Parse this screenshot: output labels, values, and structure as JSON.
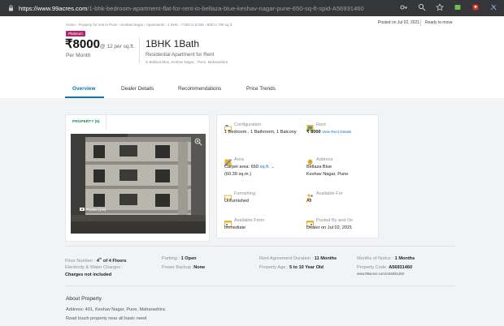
{
  "browser": {
    "url_host": "https://www.99acres.com",
    "url_path": "/1-bhk-bedroom-apartment-flat-for-rent-in-bellaza-blue-keshav-nagar-pune-650-sq-ft-spid-A56931460",
    "icons": [
      "key-icon",
      "search-icon",
      "star-icon",
      "extension-icon",
      "profile-icon",
      "menu-icon"
    ]
  },
  "header": {
    "breadcrumb": "Home › Property for rent in Pune › Keshav Nagar › Apartments › 1 BHK › 7,000 to 8,000 › 600 to 700 sq.ft.",
    "posted_on": "Posted on Jul 02, 2021",
    "status": "Ready to move",
    "badge": "Platinum",
    "price": "₹8000",
    "price_sqft": "@ 12 per sq.ft.",
    "per_month": "Per Month",
    "title": "1BHK 1Bath",
    "subtitle": "Residential Apartment for Rent",
    "address_small": "in Bellaza Blue, Keshav Nagar, , Pune, Maharashtra"
  },
  "tabs": [
    {
      "label": "Overview",
      "active": true
    },
    {
      "label": "Dealer Details",
      "active": false
    },
    {
      "label": "Recommendations",
      "active": false
    },
    {
      "label": "Price Trends",
      "active": false
    }
  ],
  "property_card": {
    "tab_label": "PROPERTY (6)",
    "photos_label": "Photos (1/6)"
  },
  "details": {
    "configuration": {
      "label": "Configuration",
      "value": "1 Bedroom , 1 Bathroom, 1 Balcony"
    },
    "rent": {
      "label": "Rent",
      "value": "₹ 8000",
      "link": "View Rent Details"
    },
    "area": {
      "label": "Area",
      "value_prefix": "Carpet area: 650",
      "unit": "sq.ft.",
      "value_sub": "(60.39 sq.m.)"
    },
    "address": {
      "label": "Address",
      "line1": "Bellaza Blue",
      "line2": "Keshav Nagar, Pune"
    },
    "furnishing": {
      "label": "Furnishing",
      "value": "Unfurnished"
    },
    "available_for": {
      "label": "Available For",
      "value": "All"
    },
    "available_from": {
      "label": "Available From",
      "value": "Immediate"
    },
    "posted_by": {
      "label": "Posted By and On",
      "value": "Dealer on Jul 02, 2021"
    }
  },
  "facts": {
    "floor_label": "Floor Number :",
    "floor_value": "4",
    "floor_sup": "th",
    "floor_of": "of 4 Floors",
    "parking_label": "Parking :",
    "parking_value": "1 Open",
    "duration_label": "Rent Agreement Duration :",
    "duration_value": "11 Months",
    "notice_label": "Months of Notice :",
    "notice_value": "1 Months",
    "charges_label": "Electricity & Water Charges :",
    "charges_value": "Charges not included",
    "backup_label": "Power Backup :",
    "backup_value": "None",
    "age_label": "Property Age :",
    "age_value": "5 to 10 Year Old",
    "code_label": "Property Code :",
    "code_value": "A56931460",
    "code_url": "www.99acres.com/A56931460"
  },
  "about": {
    "heading": "About Property",
    "address_label": "Address:",
    "address_value": "401, Keshav Nagar, Pune, Maharashtra",
    "description": "Road touch property near all basic need"
  },
  "colors": {
    "accent": "#0a78b4",
    "badge": "#b5256d",
    "property_tab": "#1e8a4b",
    "icon_yellow": "#e8b32a"
  }
}
